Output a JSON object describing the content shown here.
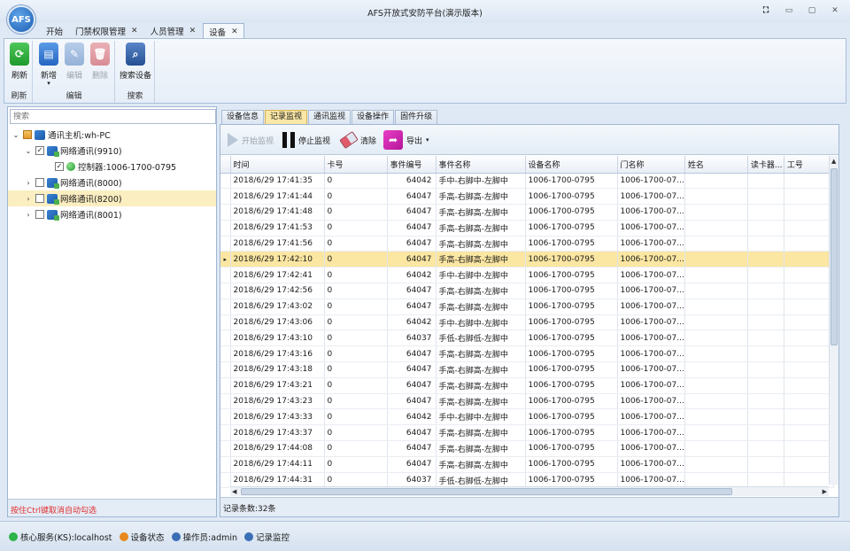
{
  "app": {
    "logo_text": "AFS",
    "title": "AFS开放式安防平台(演示版本)"
  },
  "window_buttons": [
    "⛶",
    "▭",
    "▢",
    "✕"
  ],
  "doc_tabs": [
    {
      "label": "开始",
      "closable": false,
      "active": false
    },
    {
      "label": "门禁权限管理",
      "closable": true,
      "active": false
    },
    {
      "label": "人员管理",
      "closable": true,
      "active": false
    },
    {
      "label": "设备",
      "closable": true,
      "active": true
    }
  ],
  "ribbon": {
    "groups": [
      {
        "name": "刷新",
        "buttons": [
          {
            "label": "刷新",
            "icon": "refresh-icon",
            "enabled": true
          }
        ]
      },
      {
        "name": "编辑",
        "buttons": [
          {
            "label": "新增",
            "icon": "add-icon",
            "enabled": true,
            "dropdown": true
          },
          {
            "label": "编辑",
            "icon": "edit-icon",
            "enabled": false
          },
          {
            "label": "删除",
            "icon": "delete-icon",
            "enabled": false
          }
        ]
      },
      {
        "name": "搜索",
        "buttons": [
          {
            "label": "搜索设备",
            "icon": "search-device-icon",
            "enabled": true
          }
        ]
      }
    ]
  },
  "left": {
    "search_placeholder": "搜索",
    "tree": [
      {
        "label": "通讯主机:wh-PC",
        "level": 0,
        "expanded": true,
        "check": "partial",
        "icon": "host-icon"
      },
      {
        "label": "网络通讯(9910)",
        "level": 1,
        "expanded": true,
        "check": "checked",
        "icon": "network-icon"
      },
      {
        "label": "控制器:1006-1700-0795",
        "level": 2,
        "expanded": null,
        "check": "checked",
        "icon": "controller-online-icon"
      },
      {
        "label": "网络通讯(8000)",
        "level": 1,
        "expanded": false,
        "check": "unchecked",
        "icon": "network-icon"
      },
      {
        "label": "网络通讯(8200)",
        "level": 1,
        "expanded": false,
        "check": "unchecked",
        "icon": "network-icon",
        "selected": true
      },
      {
        "label": "网络通讯(8001)",
        "level": 1,
        "expanded": false,
        "check": "unchecked",
        "icon": "network-icon"
      }
    ],
    "hint": "按住Ctrl键取消自动勾选"
  },
  "right_tabs": [
    {
      "label": "设备信息",
      "active": false
    },
    {
      "label": "记录监视",
      "active": true
    },
    {
      "label": "通讯监视",
      "active": false
    },
    {
      "label": "设备操作",
      "active": false
    },
    {
      "label": "固件升级",
      "active": false
    }
  ],
  "toolbar": {
    "start_label": "开始监视",
    "stop_label": "停止监视",
    "clear_label": "清除",
    "export_label": "导出"
  },
  "grid": {
    "columns": [
      "时间",
      "卡号",
      "事件编号",
      "事件名称",
      "设备名称",
      "门名称",
      "姓名",
      "读卡器...",
      "工号"
    ],
    "selected_row": 5,
    "rows": [
      [
        "2018/6/29 17:41:35",
        "0",
        "64042",
        "手中-右脚中-左脚中",
        "1006-1700-0795",
        "1006-1700-07...",
        "",
        "",
        ""
      ],
      [
        "2018/6/29 17:41:44",
        "0",
        "64047",
        "手高-右脚高-左脚中",
        "1006-1700-0795",
        "1006-1700-07...",
        "",
        "",
        ""
      ],
      [
        "2018/6/29 17:41:48",
        "0",
        "64047",
        "手高-右脚高-左脚中",
        "1006-1700-0795",
        "1006-1700-07...",
        "",
        "",
        ""
      ],
      [
        "2018/6/29 17:41:53",
        "0",
        "64047",
        "手高-右脚高-左脚中",
        "1006-1700-0795",
        "1006-1700-07...",
        "",
        "",
        ""
      ],
      [
        "2018/6/29 17:41:56",
        "0",
        "64047",
        "手高-右脚高-左脚中",
        "1006-1700-0795",
        "1006-1700-07...",
        "",
        "",
        ""
      ],
      [
        "2018/6/29 17:42:10",
        "0",
        "64047",
        "手高-右脚高-左脚中",
        "1006-1700-0795",
        "1006-1700-07...",
        "",
        "",
        ""
      ],
      [
        "2018/6/29 17:42:41",
        "0",
        "64042",
        "手中-右脚中-左脚中",
        "1006-1700-0795",
        "1006-1700-07...",
        "",
        "",
        ""
      ],
      [
        "2018/6/29 17:42:56",
        "0",
        "64047",
        "手高-右脚高-左脚中",
        "1006-1700-0795",
        "1006-1700-07...",
        "",
        "",
        ""
      ],
      [
        "2018/6/29 17:43:02",
        "0",
        "64047",
        "手高-右脚高-左脚中",
        "1006-1700-0795",
        "1006-1700-07...",
        "",
        "",
        ""
      ],
      [
        "2018/6/29 17:43:06",
        "0",
        "64042",
        "手中-右脚中-左脚中",
        "1006-1700-0795",
        "1006-1700-07...",
        "",
        "",
        ""
      ],
      [
        "2018/6/29 17:43:10",
        "0",
        "64037",
        "手低-右脚低-左脚中",
        "1006-1700-0795",
        "1006-1700-07...",
        "",
        "",
        ""
      ],
      [
        "2018/6/29 17:43:16",
        "0",
        "64047",
        "手高-右脚高-左脚中",
        "1006-1700-0795",
        "1006-1700-07...",
        "",
        "",
        ""
      ],
      [
        "2018/6/29 17:43:18",
        "0",
        "64047",
        "手高-右脚高-左脚中",
        "1006-1700-0795",
        "1006-1700-07...",
        "",
        "",
        ""
      ],
      [
        "2018/6/29 17:43:21",
        "0",
        "64047",
        "手高-右脚高-左脚中",
        "1006-1700-0795",
        "1006-1700-07...",
        "",
        "",
        ""
      ],
      [
        "2018/6/29 17:43:23",
        "0",
        "64047",
        "手高-右脚高-左脚中",
        "1006-1700-0795",
        "1006-1700-07...",
        "",
        "",
        ""
      ],
      [
        "2018/6/29 17:43:33",
        "0",
        "64042",
        "手中-右脚中-左脚中",
        "1006-1700-0795",
        "1006-1700-07...",
        "",
        "",
        ""
      ],
      [
        "2018/6/29 17:43:37",
        "0",
        "64047",
        "手高-右脚高-左脚中",
        "1006-1700-0795",
        "1006-1700-07...",
        "",
        "",
        ""
      ],
      [
        "2018/6/29 17:44:08",
        "0",
        "64047",
        "手高-右脚高-左脚中",
        "1006-1700-0795",
        "1006-1700-07...",
        "",
        "",
        ""
      ],
      [
        "2018/6/29 17:44:11",
        "0",
        "64047",
        "手高-右脚高-左脚中",
        "1006-1700-0795",
        "1006-1700-07...",
        "",
        "",
        ""
      ],
      [
        "2018/6/29 17:44:31",
        "0",
        "64037",
        "手低-右脚低-左脚中",
        "1006-1700-0795",
        "1006-1700-07...",
        "",
        "",
        ""
      ]
    ],
    "record_count": "记录条数:32条"
  },
  "status": [
    {
      "label": "核心服务(KS):localhost",
      "color": "#2fb34a"
    },
    {
      "label": "设备状态",
      "color": "#e8891d"
    },
    {
      "label": "操作员:admin",
      "color": "#3a6fb5"
    },
    {
      "label": "记录监控",
      "color": "#3a6fb5"
    }
  ]
}
